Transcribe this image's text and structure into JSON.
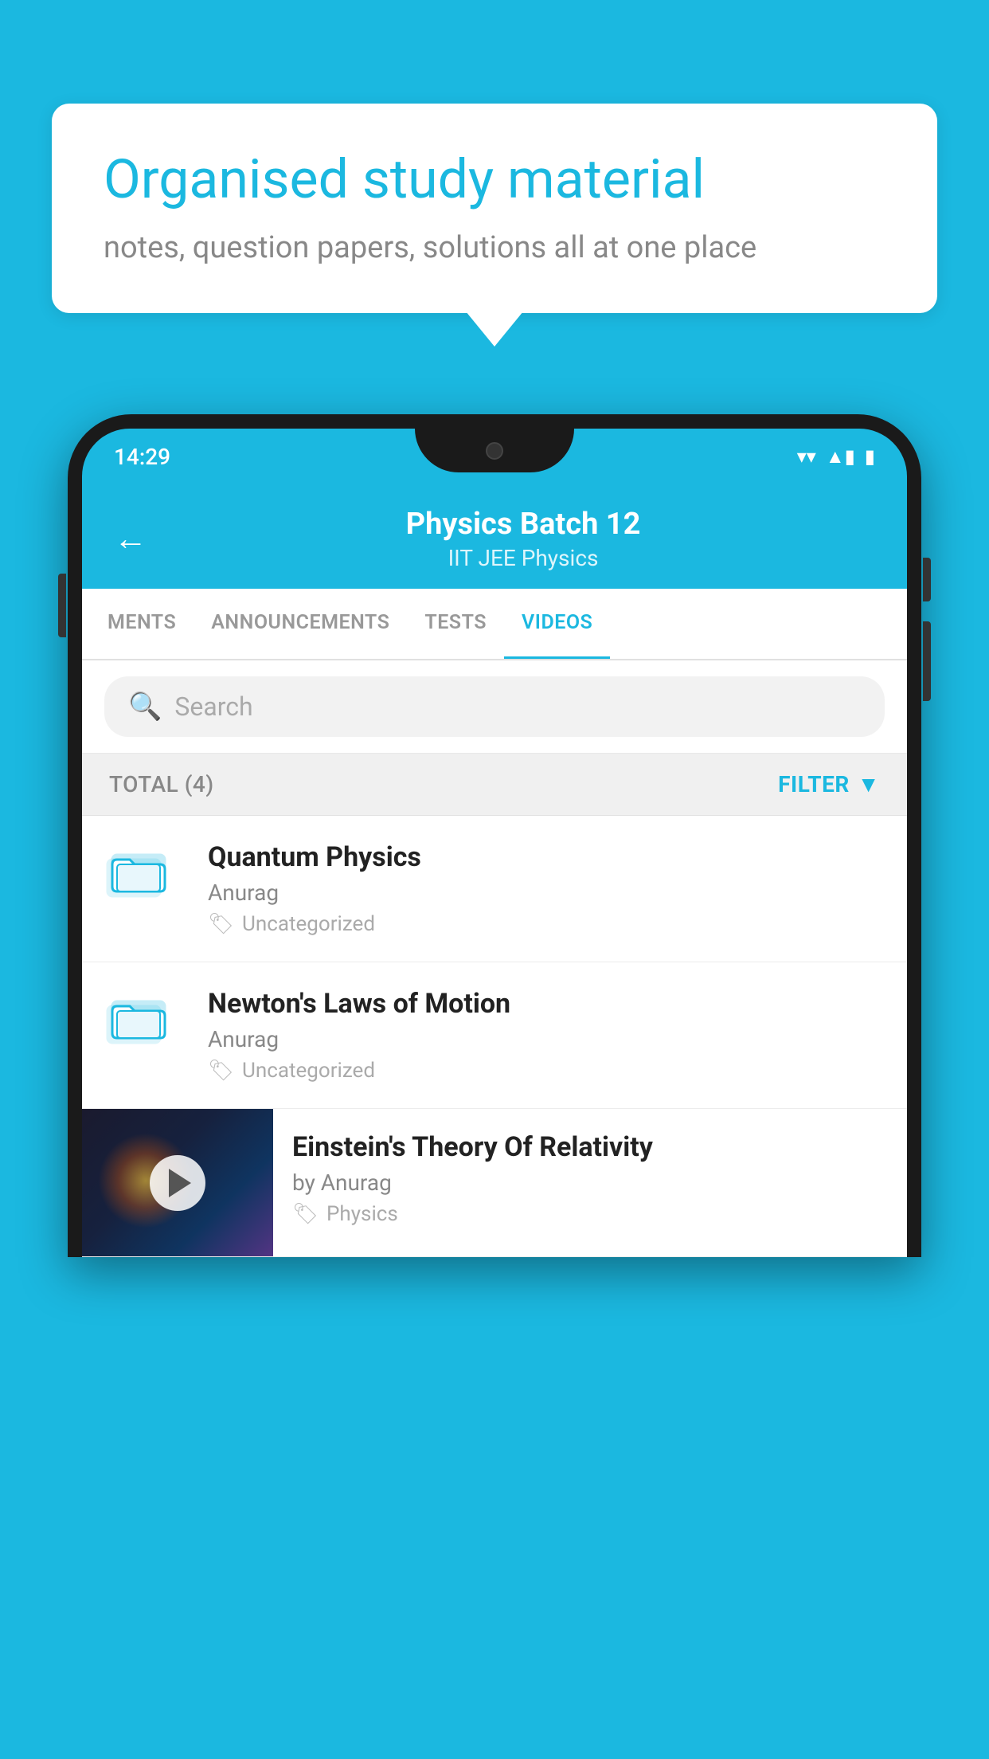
{
  "background_color": "#1bb8e0",
  "speech_bubble": {
    "title": "Organised study material",
    "subtitle": "notes, question papers, solutions all at one place"
  },
  "status_bar": {
    "time": "14:29",
    "wifi_icon": "▼",
    "signal_icon": "▲",
    "battery_icon": "▮"
  },
  "header": {
    "title": "Physics Batch 12",
    "subtitle": "IIT JEE    Physics",
    "back_label": "back"
  },
  "tabs": [
    {
      "label": "MENTS",
      "active": false
    },
    {
      "label": "ANNOUNCEMENTS",
      "active": false
    },
    {
      "label": "TESTS",
      "active": false
    },
    {
      "label": "VIDEOS",
      "active": true
    }
  ],
  "search": {
    "placeholder": "Search"
  },
  "filter_bar": {
    "total_label": "TOTAL (4)",
    "filter_label": "FILTER"
  },
  "video_items": [
    {
      "title": "Quantum Physics",
      "author": "Anurag",
      "tag": "Uncategorized",
      "has_thumbnail": false
    },
    {
      "title": "Newton's Laws of Motion",
      "author": "Anurag",
      "tag": "Uncategorized",
      "has_thumbnail": false
    },
    {
      "title": "Einstein's Theory Of Relativity",
      "author": "by Anurag",
      "tag": "Physics",
      "has_thumbnail": true
    }
  ]
}
